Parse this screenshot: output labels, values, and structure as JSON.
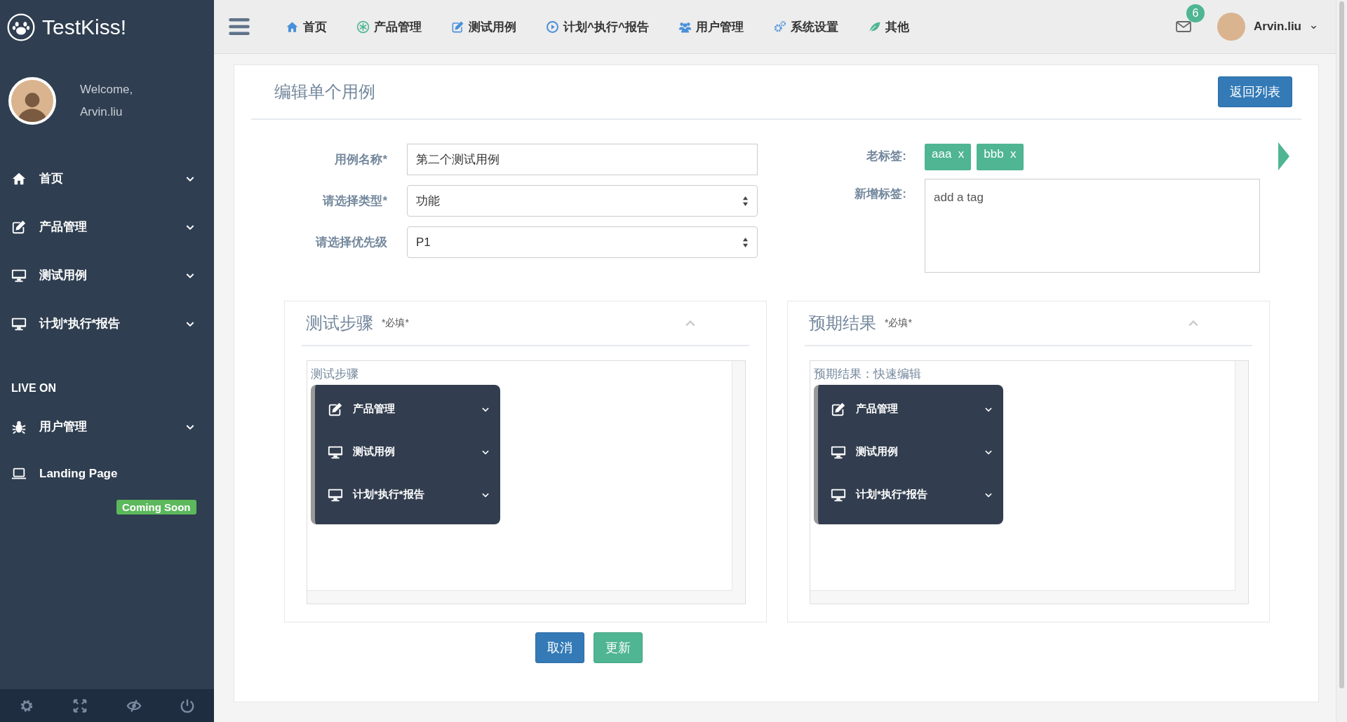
{
  "brand": {
    "name": "TestKiss!"
  },
  "profile": {
    "greeting": "Welcome,",
    "user": "Arvin.liu"
  },
  "sidebar": {
    "items": [
      {
        "kind": "menu",
        "label": "首页"
      },
      {
        "kind": "menu",
        "label": "产品管理"
      },
      {
        "kind": "menu",
        "label": "测试用例"
      },
      {
        "kind": "menu",
        "label": "计划*执行*报告"
      },
      {
        "kind": "heading",
        "label": "LIVE ON"
      },
      {
        "kind": "menu",
        "label": "用户管理"
      },
      {
        "kind": "link",
        "label": "Landing Page",
        "badge": "Coming Soon"
      }
    ]
  },
  "top_nav": {
    "items": [
      {
        "label": "首页"
      },
      {
        "label": "产品管理"
      },
      {
        "label": "测试用例"
      },
      {
        "label": "计划^执行^报告"
      },
      {
        "label": "用户管理"
      },
      {
        "label": "系统设置"
      },
      {
        "label": "其他"
      }
    ],
    "notifications": "6",
    "user": "Arvin.liu"
  },
  "page": {
    "title": "编辑单个用例",
    "back_button": "返回列表"
  },
  "form": {
    "fields": [
      {
        "kind": "text",
        "label": "用例名称*",
        "value": "第二个测试用例"
      },
      {
        "kind": "select",
        "label": "请选择类型*",
        "value": "功能"
      },
      {
        "kind": "select",
        "label": "请选择优先级",
        "value": "P1"
      }
    ],
    "old_tags": {
      "label": "老标签:",
      "tags": [
        {
          "label": "aaa",
          "remove": "x"
        },
        {
          "label": "bbb",
          "remove": "x"
        }
      ]
    },
    "new_tag": {
      "label": "新增标签:",
      "placeholder": "add a tag"
    }
  },
  "panels": [
    {
      "title": "测试步骤",
      "note": "*必填*",
      "editor_label": "测试步骤",
      "menu": [
        {
          "label": "产品管理"
        },
        {
          "label": "测试用例"
        },
        {
          "label": "计划*执行*报告"
        }
      ]
    },
    {
      "title": "预期结果",
      "note": "*必填*",
      "editor_label": "预期结果：快速编辑",
      "menu": [
        {
          "label": "产品管理"
        },
        {
          "label": "测试用例"
        },
        {
          "label": "计划*执行*报告"
        }
      ]
    }
  ],
  "actions": [
    {
      "kind": "primary",
      "label": "取消"
    },
    {
      "kind": "success",
      "label": "更新"
    }
  ]
}
